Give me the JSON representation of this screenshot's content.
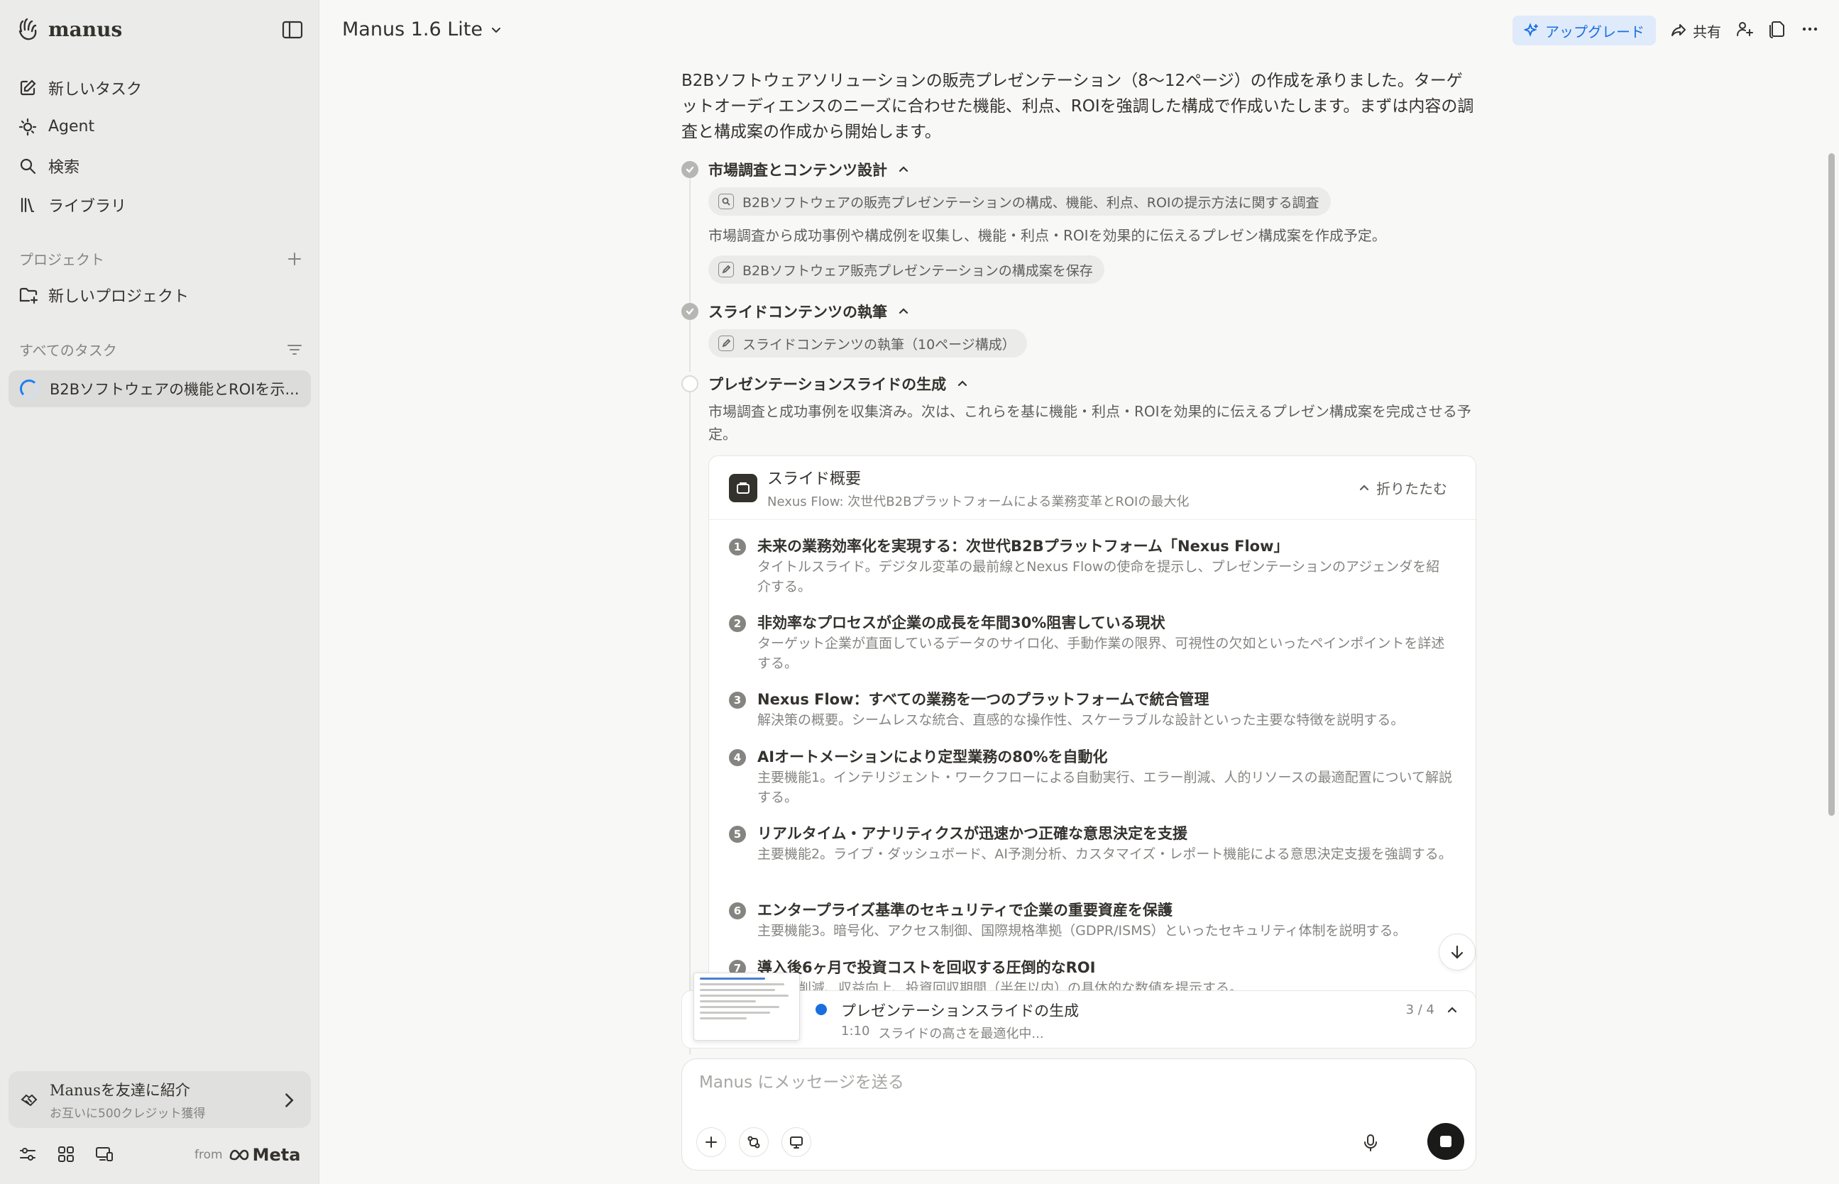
{
  "app": {
    "name": "manus"
  },
  "sidebar": {
    "nav": [
      {
        "label": "新しいタスク",
        "icon": "edit-icon"
      },
      {
        "label": "Agent",
        "icon": "agent-icon"
      },
      {
        "label": "検索",
        "icon": "search-icon"
      },
      {
        "label": "ライブラリ",
        "icon": "library-icon"
      }
    ],
    "projects_heading": "プロジェクト",
    "new_project_label": "新しいプロジェクト",
    "all_tasks_heading": "すべてのタスク",
    "tasks": [
      {
        "label": "B2Bソフトウェアの機能とROIを示...",
        "status": "running"
      }
    ],
    "referral": {
      "title": "Manusを友達に紹介",
      "subtitle": "お互いに500クレジット獲得"
    },
    "from_label": "from",
    "meta_label": "Meta"
  },
  "header": {
    "model": "Manus 1.6 Lite",
    "upgrade_label": "アップグレード",
    "share_label": "共有",
    "accent_color": "#1a6fe0"
  },
  "conversation": {
    "intro": "B2Bソフトウェアソリューションの販売プレゼンテーション（8〜12ページ）の作成を承りました。ターゲットオーディエンスのニーズに合わせた機能、利点、ROIを強調した構成で作成いたします。まずは内容の調査と構成案の作成から開始します。",
    "steps": [
      {
        "title": "市場調査とコンテンツ設計",
        "status": "done",
        "research_pill": "B2Bソフトウェアの販売プレゼンテーションの構成、機能、利点、ROIの提示方法に関する調査",
        "note": "市場調査から成功事例や構成例を収集し、機能・利点・ROIを効果的に伝えるプレゼン構成案を作成予定。",
        "save_pill": "B2Bソフトウェア販売プレゼンテーションの構成案を保存"
      },
      {
        "title": "スライドコンテンツの執筆",
        "status": "done",
        "pill": "スライドコンテンツの執筆（10ページ構成）"
      },
      {
        "title": "プレゼンテーションスライドの生成",
        "status": "in-progress",
        "note": "市場調査と成功事例を収集済み。次は、これらを基に機能・利点・ROIを効果的に伝えるプレゼン構成案を完成させる予定。"
      }
    ],
    "outline": {
      "title": "スライド概要",
      "subtitle": "Nexus Flow: 次世代B2Bプラットフォームによる業務変革とROIの最大化",
      "collapse_label": "折りたたむ",
      "slides": [
        {
          "num": "1",
          "title": "未来の業務効率化を実現する：次世代B2Bプラットフォーム「Nexus Flow」",
          "desc": "タイトルスライド。デジタル変革の最前線とNexus Flowの使命を提示し、プレゼンテーションのアジェンダを紹介する。"
        },
        {
          "num": "2",
          "title": "非効率なプロセスが企業の成長を年間30%阻害している現状",
          "desc": "ターゲット企業が直面しているデータのサイロ化、手動作業の限界、可視性の欠如といったペインポイントを詳述する。"
        },
        {
          "num": "3",
          "title": "Nexus Flow：すべての業務を一つのプラットフォームで統合管理",
          "desc": "解決策の概要。シームレスな統合、直感的な操作性、スケーラブルな設計といった主要な特徴を説明する。"
        },
        {
          "num": "4",
          "title": "AIオートメーションにより定型業務の80%を自動化",
          "desc": "主要機能1。インテリジェント・ワークフローによる自動実行、エラー削減、人的リソースの最適配置について解説する。"
        },
        {
          "num": "5",
          "title": "リアルタイム・アナリティクスが迅速かつ正確な意思決定を支援",
          "desc": "主要機能2。ライブ・ダッシュボード、AI予測分析、カスタマイズ・レポート機能による意思決定支援を強調する。"
        },
        {
          "num": "6",
          "title": "エンタープライズ基準のセキュリティで企業の重要資産を保護",
          "desc": "主要機能3。暗号化、アクセス制御、国際規格準拠（GDPR/ISMS）といったセキュリティ体制を説明する。"
        },
        {
          "num": "7",
          "title": "導入後6ヶ月で投資コストを回収する圧倒的なROI",
          "desc": "コスト削減、収益向上、投資回収期間（半年以内）の具体的な数値を提示する。"
        }
      ]
    }
  },
  "progress": {
    "title": "プレゼンテーションスライドの生成",
    "time": "1:10",
    "status": "スライドの高さを最適化中...",
    "count": "3 / 4"
  },
  "composer": {
    "placeholder": "Manus にメッセージを送る"
  }
}
